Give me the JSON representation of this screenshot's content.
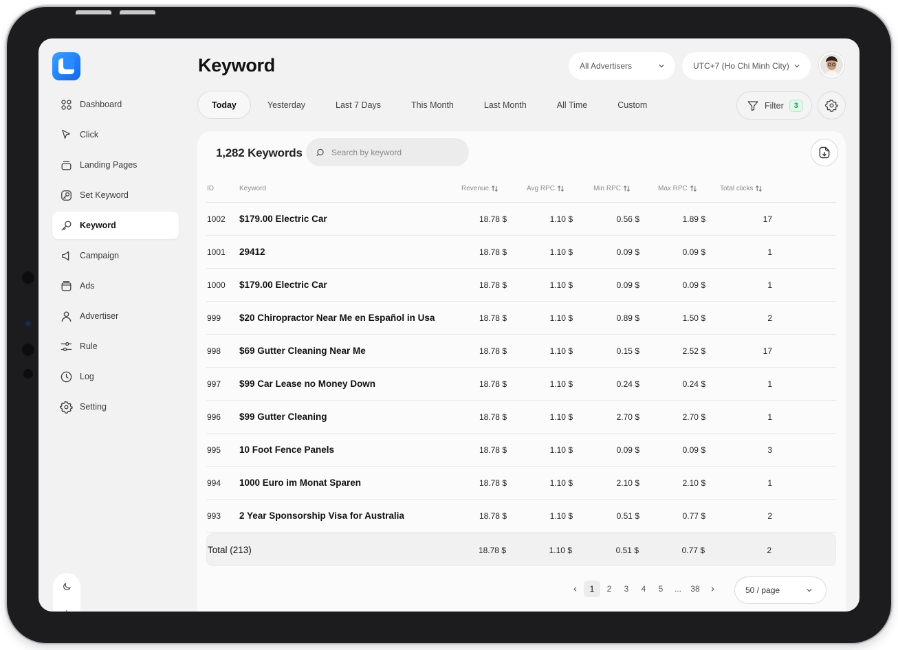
{
  "app": {
    "title": "Keyword"
  },
  "sidebar": {
    "items": [
      {
        "label": "Dashboard",
        "icon": "dashboard-grid-icon",
        "active": false
      },
      {
        "label": "Click",
        "icon": "cursor-click-icon",
        "active": false
      },
      {
        "label": "Landing Pages",
        "icon": "landing-pages-icon",
        "active": false
      },
      {
        "label": "Set Keyword",
        "icon": "set-keyword-icon",
        "active": false
      },
      {
        "label": "Keyword",
        "icon": "key-icon",
        "active": true
      },
      {
        "label": "Campaign",
        "icon": "megaphone-icon",
        "active": false
      },
      {
        "label": "Ads",
        "icon": "ads-folder-icon",
        "active": false
      },
      {
        "label": "Advertiser",
        "icon": "user-icon",
        "active": false
      },
      {
        "label": "Rule",
        "icon": "sliders-icon",
        "active": false
      },
      {
        "label": "Log",
        "icon": "clock-icon",
        "active": false
      },
      {
        "label": "Setting",
        "icon": "gear-icon",
        "active": false
      }
    ]
  },
  "header": {
    "advertiser_select": "All Advertisers",
    "timezone_select": "UTC+7 (Ho Chi Minh City)"
  },
  "date_tabs": [
    {
      "label": "Today",
      "active": true
    },
    {
      "label": "Yesterday",
      "active": false
    },
    {
      "label": "Last 7 Days",
      "active": false
    },
    {
      "label": "This Month",
      "active": false
    },
    {
      "label": "Last Month",
      "active": false
    },
    {
      "label": "All Time",
      "active": false
    },
    {
      "label": "Custom",
      "active": false
    }
  ],
  "filter": {
    "label": "Filter",
    "count": "3"
  },
  "table": {
    "count_label": "1,282 Keywords",
    "search_placeholder": "Search by keyword",
    "columns": {
      "id": "ID",
      "keyword": "Keyword",
      "revenue": "Revenue",
      "avg_rpc": "Avg RPC",
      "min_rpc": "Min RPC",
      "max_rpc": "Max RPC",
      "total_clicks": "Total clicks"
    },
    "rows": [
      {
        "id": "1002",
        "keyword": "$179.00 Electric Car",
        "revenue": "18.78 $",
        "avg_rpc": "1.10 $",
        "min_rpc": "0.56 $",
        "max_rpc": "1.89 $",
        "total_clicks": "17"
      },
      {
        "id": "1001",
        "keyword": "29412",
        "revenue": "18.78 $",
        "avg_rpc": "1.10 $",
        "min_rpc": "0.09 $",
        "max_rpc": "0.09 $",
        "total_clicks": "1"
      },
      {
        "id": "1000",
        "keyword": "$179.00 Electric Car",
        "revenue": "18.78 $",
        "avg_rpc": "1.10 $",
        "min_rpc": "0.09 $",
        "max_rpc": "0.09 $",
        "total_clicks": "1"
      },
      {
        "id": "999",
        "keyword": "$20 Chiropractor Near Me en Español in Usa",
        "revenue": "18.78 $",
        "avg_rpc": "1.10 $",
        "min_rpc": "0.89 $",
        "max_rpc": "1.50 $",
        "total_clicks": "2"
      },
      {
        "id": "998",
        "keyword": "$69 Gutter Cleaning Near Me",
        "revenue": "18.78 $",
        "avg_rpc": "1.10 $",
        "min_rpc": "0.15 $",
        "max_rpc": "2.52 $",
        "total_clicks": "17"
      },
      {
        "id": "997",
        "keyword": "$99 Car Lease no Money Down",
        "revenue": "18.78 $",
        "avg_rpc": "1.10 $",
        "min_rpc": "0.24 $",
        "max_rpc": "0.24 $",
        "total_clicks": "1"
      },
      {
        "id": "996",
        "keyword": "$99 Gutter Cleaning",
        "revenue": "18.78 $",
        "avg_rpc": "1.10 $",
        "min_rpc": "2.70 $",
        "max_rpc": "2.70 $",
        "total_clicks": "1"
      },
      {
        "id": "995",
        "keyword": "10 Foot Fence Panels",
        "revenue": "18.78 $",
        "avg_rpc": "1.10 $",
        "min_rpc": "0.09 $",
        "max_rpc": "0.09 $",
        "total_clicks": "3"
      },
      {
        "id": "994",
        "keyword": "1000 Euro im Monat Sparen",
        "revenue": "18.78 $",
        "avg_rpc": "1.10 $",
        "min_rpc": "2.10 $",
        "max_rpc": "2.10 $",
        "total_clicks": "1"
      },
      {
        "id": "993",
        "keyword": "2 Year Sponsorship Visa for Australia",
        "revenue": "18.78 $",
        "avg_rpc": "1.10 $",
        "min_rpc": "0.51 $",
        "max_rpc": "0.77 $",
        "total_clicks": "2"
      }
    ],
    "total": {
      "label": "Total (213)",
      "revenue": "18.78 $",
      "avg_rpc": "1.10 $",
      "min_rpc": "0.51 $",
      "max_rpc": "0.77 $",
      "total_clicks": "2"
    }
  },
  "pagination": {
    "pages": [
      "1",
      "2",
      "3",
      "4",
      "5",
      "...",
      "38"
    ],
    "current": "1",
    "per_page": "50 / page"
  },
  "colors": {
    "accent_blue": "#1a7cf5",
    "filter_badge_green": "#1f9d55",
    "screen_bg": "#f2f2f2",
    "card_bg": "#fbfbfb"
  }
}
